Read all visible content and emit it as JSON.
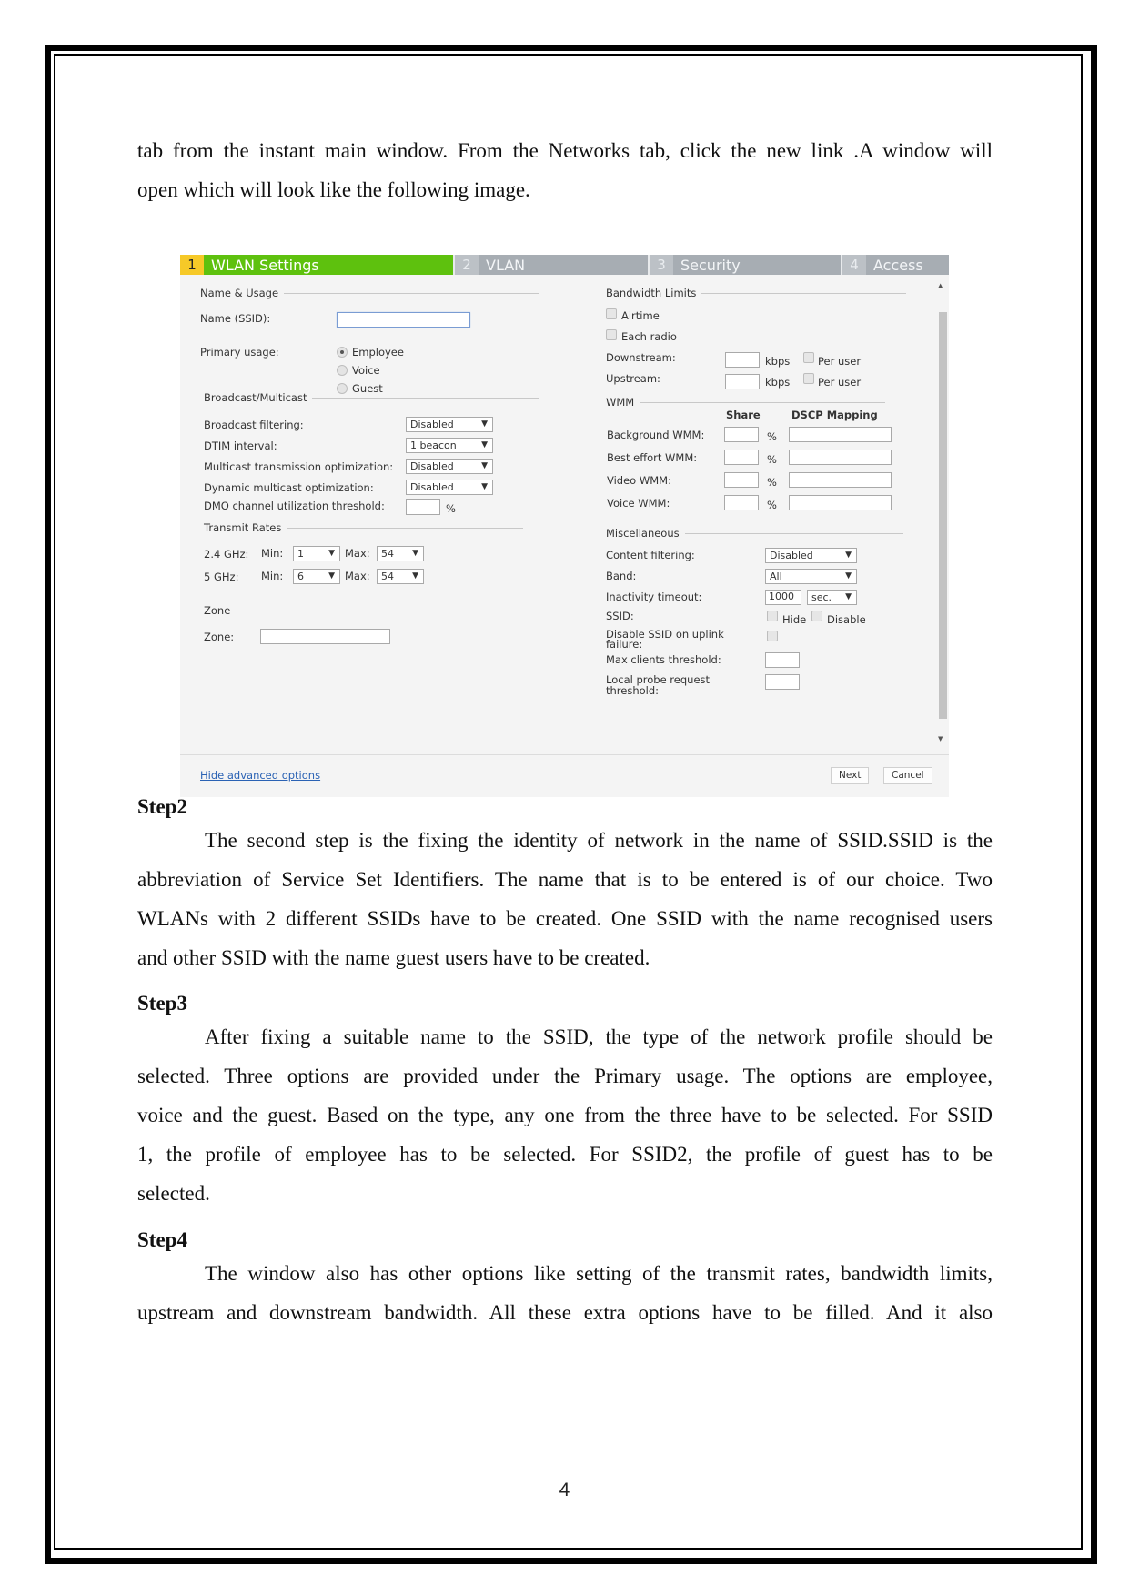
{
  "document": {
    "intro_lines": [
      "tab from the instant main window. From the Networks tab, click the new link .A window will",
      "open which will look like the following image."
    ],
    "steps": [
      {
        "heading": "Step2",
        "lines": [
          "The second step is the fixing the identity of network in the name of SSID.SSID is the",
          "abbreviation of Service Set Identifiers. The name that is to be entered is of our choice. Two",
          "WLANs with 2 different SSIDs have to be created. One SSID with the name recognised users",
          "and other SSID with the name guest users have to be created."
        ]
      },
      {
        "heading": "Step3",
        "lines": [
          "After fixing a suitable name to the SSID, the type of the network profile should be",
          "selected. Three options are provided under the Primary usage. The options are employee,",
          "voice and the guest. Based on the type, any one from the three have to be selected. For SSID",
          "1, the profile of employee has to be selected. For SSID2, the profile of guest has to be",
          "selected."
        ]
      },
      {
        "heading": "Step4",
        "lines": [
          "The window also has other options like setting of the transmit rates, bandwidth limits,",
          "upstream and downstream bandwidth. All these extra options have to be filled. And it also"
        ]
      }
    ],
    "page_number": "4"
  },
  "screenshot": {
    "tabs": [
      {
        "num": "1",
        "label": "WLAN Settings",
        "active": true
      },
      {
        "num": "2",
        "label": "VLAN",
        "active": false
      },
      {
        "num": "3",
        "label": "Security",
        "active": false
      },
      {
        "num": "4",
        "label": "Access",
        "active": false
      }
    ],
    "colors": {
      "active_tab": "#5ec10e",
      "active_num": "#f6c928",
      "inactive_tab": "#a7adb3",
      "link": "#2a62b4"
    },
    "left": {
      "name_usage": {
        "title": "Name & Usage",
        "ssid_label": "Name (SSID):",
        "ssid_value": "",
        "primary_usage_label": "Primary usage:",
        "options": [
          "Employee",
          "Voice",
          "Guest"
        ],
        "selected": "Employee"
      },
      "broadcast": {
        "title": "Broadcast/Multicast",
        "rows": [
          {
            "label": "Broadcast filtering:",
            "value": "Disabled"
          },
          {
            "label": "DTIM interval:",
            "value": "1 beacon"
          },
          {
            "label": "Multicast transmission optimization:",
            "value": "Disabled"
          },
          {
            "label": "Dynamic multicast optimization:",
            "value": "Disabled"
          }
        ],
        "dmo_label": "DMO channel utilization threshold:",
        "dmo_value": "",
        "dmo_unit": "%"
      },
      "transmit": {
        "title": "Transmit Rates",
        "min_label": "Min:",
        "max_label": "Max:",
        "rows": [
          {
            "band": "2.4 GHz:",
            "min": "1",
            "max": "54"
          },
          {
            "band": "5 GHz:",
            "min": "6",
            "max": "54"
          }
        ]
      },
      "zone": {
        "title": "Zone",
        "label": "Zone:",
        "value": ""
      }
    },
    "right": {
      "bandwidth": {
        "title": "Bandwidth Limits",
        "airtime": "Airtime",
        "each_radio": "Each radio",
        "downstream": "Downstream:",
        "upstream": "Upstream:",
        "unit": "kbps",
        "per_user": "Per user"
      },
      "wmm": {
        "title": "WMM",
        "share_header": "Share",
        "dscp_header": "DSCP Mapping",
        "rows": [
          "Background WMM:",
          "Best effort WMM:",
          "Video WMM:",
          "Voice WMM:"
        ],
        "unit": "%"
      },
      "misc": {
        "title": "Miscellaneous",
        "content_filtering_label": "Content filtering:",
        "content_filtering_value": "Disabled",
        "band_label": "Band:",
        "band_value": "All",
        "inactivity_label": "Inactivity timeout:",
        "inactivity_value": "1000",
        "inactivity_unit": "sec.",
        "ssid_label": "SSID:",
        "hide": "Hide",
        "disable": "Disable",
        "uplink_label_1": "Disable SSID on uplink",
        "uplink_label_2": "failure:",
        "max_clients_label": "Max clients threshold:",
        "local_probe_label_1": "Local probe request",
        "local_probe_label_2": "threshold:"
      }
    },
    "footer": {
      "hide_advanced": "Hide advanced options",
      "next": "Next",
      "cancel": "Cancel"
    }
  }
}
